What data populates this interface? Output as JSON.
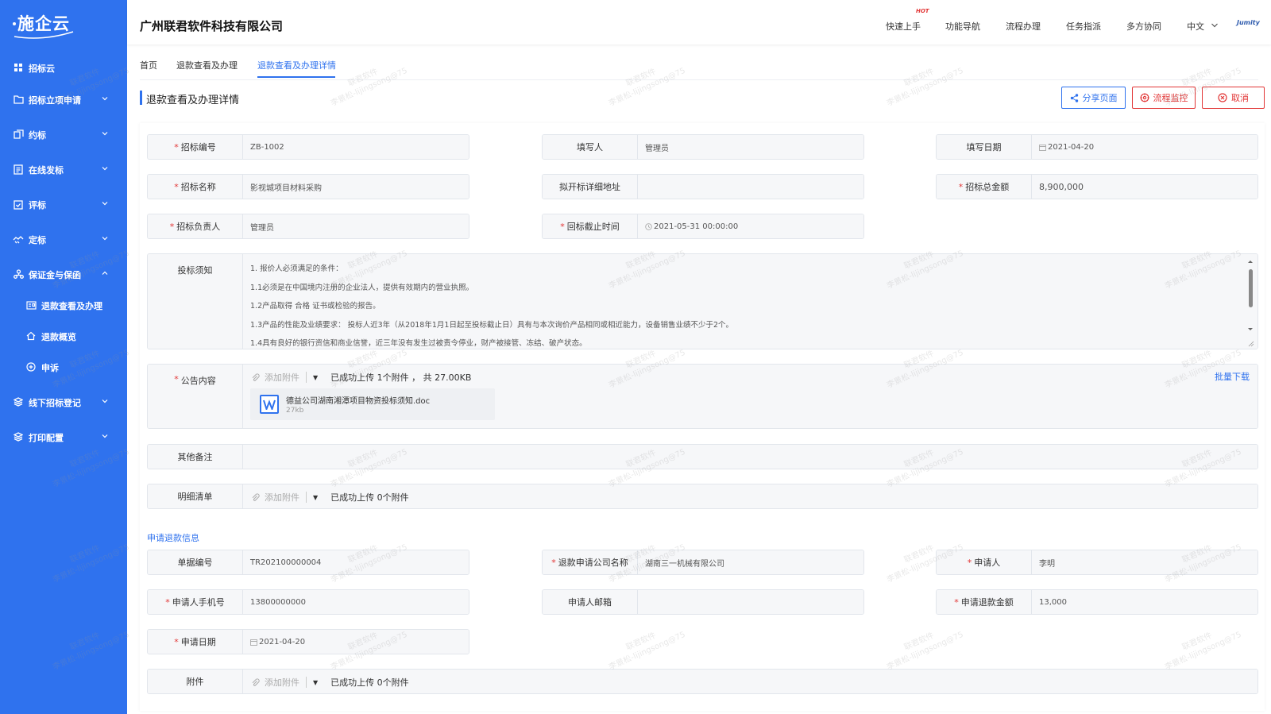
{
  "sidebar": {
    "logo": "施企云",
    "items": [
      {
        "label": "招标云",
        "icon": "grid-icon"
      },
      {
        "label": "招标立项申请",
        "icon": "folder-icon"
      },
      {
        "label": "约标",
        "icon": "coins-icon"
      },
      {
        "label": "在线发标",
        "icon": "document-icon"
      },
      {
        "label": "评标",
        "icon": "clipboard-check-icon"
      },
      {
        "label": "定标",
        "icon": "handshake-icon"
      },
      {
        "label": "保证金与保函",
        "icon": "org-tree-icon"
      },
      {
        "label": "退款查看及办理",
        "icon": "id-card-icon"
      },
      {
        "label": "退款概览",
        "icon": "home-icon"
      },
      {
        "label": "申诉",
        "icon": "appeal-icon"
      },
      {
        "label": "线下招标登记",
        "icon": "layers-icon"
      },
      {
        "label": "打印配置",
        "icon": "layers-icon"
      }
    ]
  },
  "header": {
    "company": "广州联君软件科技有限公司",
    "nav": [
      "快速上手",
      "功能导航",
      "流程办理",
      "任务指派",
      "多方协同"
    ],
    "hot_badge": "HOT",
    "language": "中文",
    "user_logo": "Jumity"
  },
  "tabs": [
    "首页",
    "退款查看及办理",
    "退款查看及办理详情"
  ],
  "page": {
    "title": "退款查看及办理详情",
    "buttons": {
      "share": "分享页面",
      "monitor": "流程监控",
      "cancel": "取消"
    }
  },
  "form": {
    "bid_no": {
      "label": "招标编号",
      "value": "ZB-1002"
    },
    "filler": {
      "label": "填写人",
      "value": "管理员"
    },
    "fill_date": {
      "label": "填写日期",
      "value": "2021-04-20"
    },
    "bid_name": {
      "label": "招标名称",
      "value": "影视城项目材料采购"
    },
    "open_address": {
      "label": "拟开标详细地址",
      "value": ""
    },
    "total_amount": {
      "label": "招标总金额",
      "value": "8,900,000"
    },
    "bid_manager": {
      "label": "招标负责人",
      "value": "管理员"
    },
    "deadline": {
      "label": "回标截止时间",
      "value": "2021-05-31 00:00:00"
    },
    "notice": {
      "label": "投标须知",
      "lines": [
        "1. 报价人必须满足的条件：",
        "1.1必须是在中国境内注册的企业法人，提供有效期内的营业执照。",
        "1.2产品取得 合格 证书或检验的报告。",
        "1.3产品的性能及业绩要求： 投标人近3年（从2018年1月1日起至投标截止日）具有与本次询价产品相同或相近能力，设备销售业绩不少于2个。",
        "1.4具有良好的银行资信和商业信誉，近三年没有发生过被责令停业，财产被接管、冻结、破产状态。"
      ]
    },
    "announcement": {
      "label": "公告内容",
      "add": "添加附件",
      "status": "已成功上传 1个附件 ， 共 27.00KB",
      "batch_download": "批量下载",
      "file_name": "德益公司湖南湘潭项目物资投标须知.doc",
      "file_size": "27kb"
    },
    "remarks": {
      "label": "其他备注",
      "value": ""
    },
    "detail_list": {
      "label": "明细清单",
      "add": "添加附件",
      "status": "已成功上传 0个附件"
    }
  },
  "refund": {
    "section_title": "申请退款信息",
    "doc_no": {
      "label": "单据编号",
      "value": "TR202100000004"
    },
    "company": {
      "label": "退款申请公司名称",
      "value": "湖南三一机械有限公司"
    },
    "applicant": {
      "label": "申请人",
      "value": "李明"
    },
    "phone": {
      "label": "申请人手机号",
      "value": "13800000000"
    },
    "email": {
      "label": "申请人邮箱",
      "value": ""
    },
    "amount": {
      "label": "申请退款金额",
      "value": "13,000"
    },
    "date": {
      "label": "申请日期",
      "value": "2021-04-20"
    },
    "attachment": {
      "label": "附件",
      "add": "添加附件",
      "status": "已成功上传 0个附件"
    }
  },
  "watermark": {
    "line1": "联君软件",
    "line2": "李景松-lijingsong@75"
  },
  "colors": {
    "primary": "#2f72ee",
    "danger": "#e23636",
    "sidebar": "#2f72ee"
  }
}
